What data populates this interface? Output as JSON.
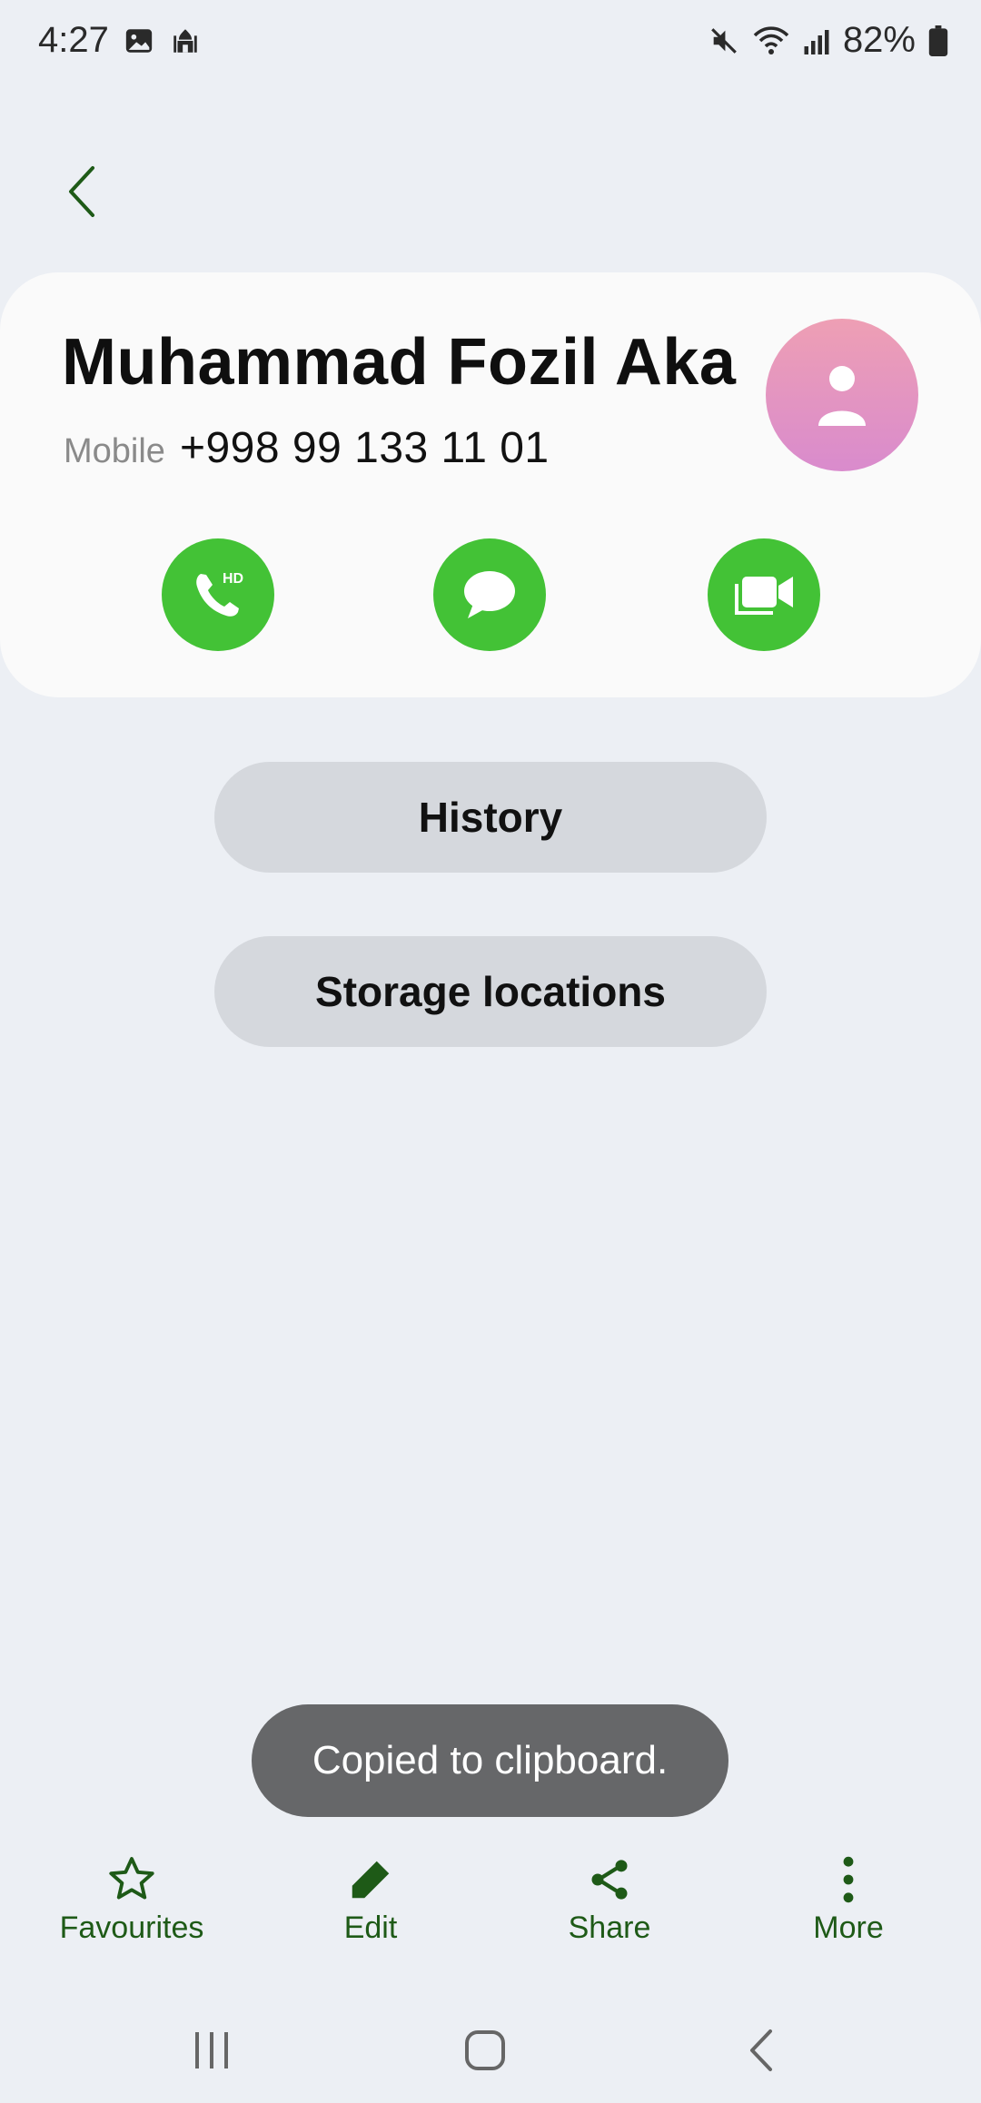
{
  "status_bar": {
    "time": "4:27",
    "battery": "82%"
  },
  "contact": {
    "name": "Muhammad Fozil Aka",
    "phone_type": "Mobile",
    "phone_number": "+998 99 133 11 01",
    "call_badge": "HD"
  },
  "buttons": {
    "history": "History",
    "storage": "Storage locations"
  },
  "toast": "Copied to clipboard.",
  "toolbar": {
    "favourites": "Favourites",
    "edit": "Edit",
    "share": "Share",
    "more": "More"
  },
  "colors": {
    "accent_green": "#43c236",
    "toolbar_green": "#1e5a17",
    "background": "#eceff4"
  }
}
